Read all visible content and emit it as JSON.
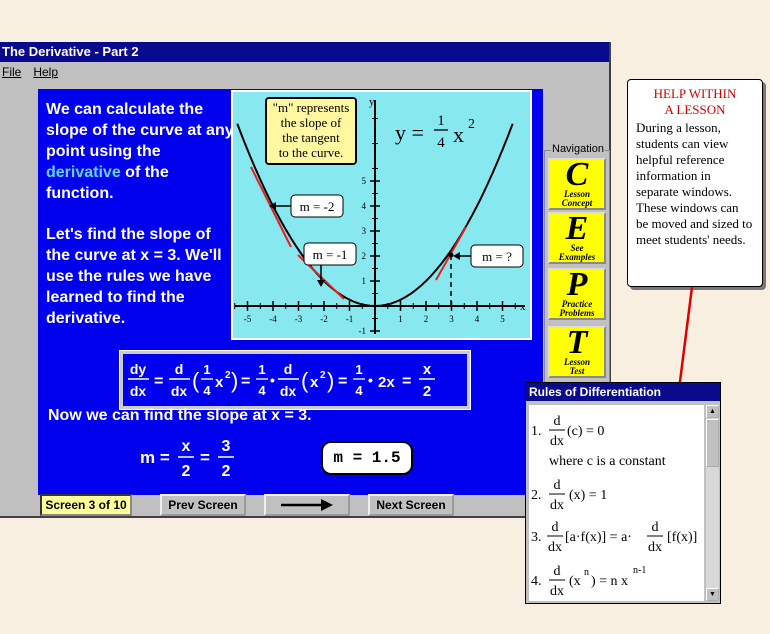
{
  "window": {
    "title": "The Derivative - Part 2"
  },
  "menu": {
    "file": "File",
    "help": "Help"
  },
  "lesson": {
    "para1_a": "We can calculate the slope of the curve at any point using the",
    "para1_hl": "derivative",
    "para1_b": "of the function.",
    "para2": "Let's find the slope of the curve at x = 3. We'll use the rules we have learned to find the derivative.",
    "slope_line": "Now we can find the slope at x = 3.",
    "m_answer": "m = 1.5"
  },
  "graph": {
    "callout": [
      "\"m\" represents",
      "the slope of",
      "the tangent",
      "to the curve."
    ],
    "m_neg2": "m = -2",
    "m_neg1": "m = -1",
    "m_q": "m = ?",
    "axis_x": "x",
    "axis_y": "y",
    "x_ticks": [
      "-5",
      "-4",
      "-3",
      "-2",
      "-1",
      "1",
      "2",
      "3",
      "4",
      "5"
    ],
    "y_ticks": [
      "5",
      "4",
      "3",
      "2",
      "1",
      "-1"
    ]
  },
  "navigation": {
    "label": "Navigation",
    "buttons": [
      {
        "letter": "C",
        "line1": "Lesson",
        "line2": "Concept"
      },
      {
        "letter": "E",
        "line1": "See",
        "line2": "Examples"
      },
      {
        "letter": "P",
        "line1": "Practice",
        "line2": "Problems"
      },
      {
        "letter": "T",
        "line1": "Lesson",
        "line2": "Test"
      }
    ]
  },
  "bottom": {
    "screen": "Screen 3 of 10",
    "prev": "Prev Screen",
    "next": "Next Screen"
  },
  "help": {
    "title_1": "HELP WITHIN",
    "title_2": "A LESSON",
    "body": "During a lesson, students can view helpful reference information in separate windows. These windows can be moved and sized to meet students' needs."
  },
  "rules": {
    "title": "Rules of Differentiation",
    "note": "where c is a constant"
  },
  "colors": {
    "content_bg": "#0000ee",
    "graph_bg": "#88e8f0",
    "title_bar": "#0a0a8c",
    "nav_yellow": "#ffff00",
    "callout_red": "#d00000"
  }
}
